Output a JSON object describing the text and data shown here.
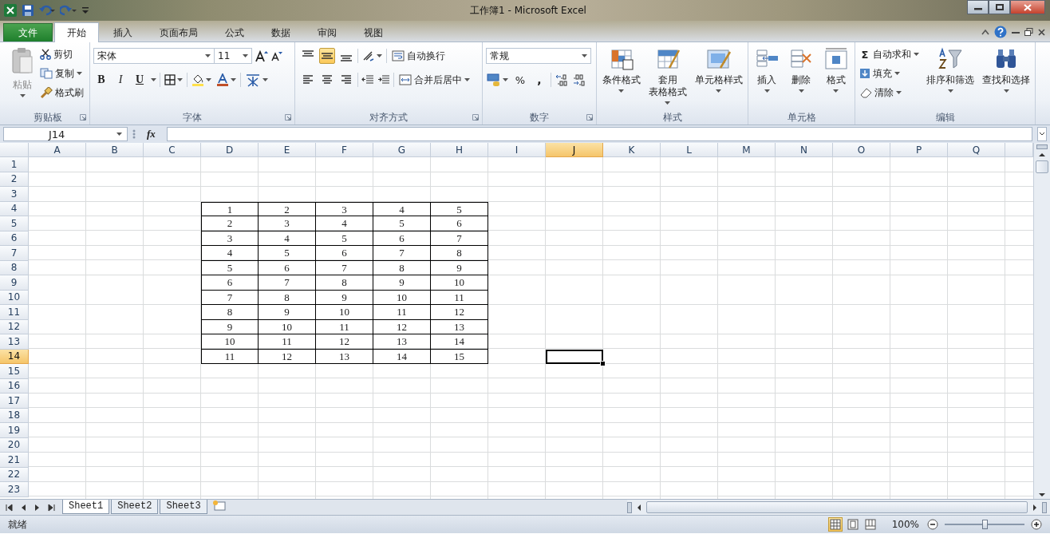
{
  "window": {
    "title": "工作簿1 - Microsoft Excel"
  },
  "ribbon_tabs": [
    {
      "label": "文件",
      "kind": "file",
      "selected": false
    },
    {
      "label": "开始",
      "kind": "tab",
      "selected": true
    },
    {
      "label": "插入",
      "kind": "tab",
      "selected": false
    },
    {
      "label": "页面布局",
      "kind": "tab",
      "selected": false
    },
    {
      "label": "公式",
      "kind": "tab",
      "selected": false
    },
    {
      "label": "数据",
      "kind": "tab",
      "selected": false
    },
    {
      "label": "审阅",
      "kind": "tab",
      "selected": false
    },
    {
      "label": "视图",
      "kind": "tab",
      "selected": false
    }
  ],
  "clipboard": {
    "label": "剪贴板",
    "paste": "粘贴",
    "cut": "剪切",
    "copy": "复制",
    "format_painter": "格式刷"
  },
  "font": {
    "label": "字体",
    "font_name": "宋体",
    "font_size": "11",
    "bold": "B",
    "italic": "I",
    "underline": "U"
  },
  "alignment": {
    "label": "对齐方式",
    "vertical": [
      {
        "selected": false
      },
      {
        "selected": true
      },
      {
        "selected": false
      }
    ],
    "wrap_text": "自动换行",
    "merge_center": "合并后居中"
  },
  "number": {
    "label": "数字",
    "format": "常规",
    "percent": "%",
    "comma": ","
  },
  "styles": {
    "label": "样式",
    "conditional_format": "条件格式",
    "table_format": [
      "套用",
      "表格格式"
    ],
    "cell_styles": "单元格样式"
  },
  "cells": {
    "label": "单元格",
    "insert": "插入",
    "delete": "删除",
    "format": "格式"
  },
  "editing": {
    "label": "编辑",
    "autosum_symbol": "Σ",
    "autosum": "自动求和",
    "fill": "填充",
    "clear": "清除",
    "sort_filter": "排序和筛选",
    "find_select": "查找和选择"
  },
  "formula_bar": {
    "name_box": "J14",
    "fx": "fx"
  },
  "columns": [
    {
      "label": "A",
      "selected": false,
      "bordered": false
    },
    {
      "label": "B",
      "selected": false,
      "bordered": false
    },
    {
      "label": "C",
      "selected": false,
      "bordered": false
    },
    {
      "label": "D",
      "selected": false,
      "bordered": true
    },
    {
      "label": "E",
      "selected": false,
      "bordered": true
    },
    {
      "label": "F",
      "selected": false,
      "bordered": true
    },
    {
      "label": "G",
      "selected": false,
      "bordered": true
    },
    {
      "label": "H",
      "selected": false,
      "bordered": true
    },
    {
      "label": "I",
      "selected": false,
      "bordered": false
    },
    {
      "label": "J",
      "selected": true,
      "bordered": false
    },
    {
      "label": "K",
      "selected": false,
      "bordered": false
    },
    {
      "label": "L",
      "selected": false,
      "bordered": false
    },
    {
      "label": "M",
      "selected": false,
      "bordered": false
    },
    {
      "label": "N",
      "selected": false,
      "bordered": false
    },
    {
      "label": "O",
      "selected": false,
      "bordered": false
    },
    {
      "label": "P",
      "selected": false,
      "bordered": false
    },
    {
      "label": "Q",
      "selected": false,
      "bordered": false
    }
  ],
  "rows": [
    {
      "label": "1",
      "selected": false,
      "bordered": false
    },
    {
      "label": "2",
      "selected": false,
      "bordered": false
    },
    {
      "label": "3",
      "selected": false,
      "bordered": false
    },
    {
      "label": "4",
      "selected": false,
      "bordered": true,
      "values": [
        "1",
        "2",
        "3",
        "4",
        "5"
      ]
    },
    {
      "label": "5",
      "selected": false,
      "bordered": true,
      "values": [
        "2",
        "3",
        "4",
        "5",
        "6"
      ]
    },
    {
      "label": "6",
      "selected": false,
      "bordered": true,
      "values": [
        "3",
        "4",
        "5",
        "6",
        "7"
      ]
    },
    {
      "label": "7",
      "selected": false,
      "bordered": true,
      "values": [
        "4",
        "5",
        "6",
        "7",
        "8"
      ]
    },
    {
      "label": "8",
      "selected": false,
      "bordered": true,
      "values": [
        "5",
        "6",
        "7",
        "8",
        "9"
      ]
    },
    {
      "label": "9",
      "selected": false,
      "bordered": true,
      "values": [
        "6",
        "7",
        "8",
        "9",
        "10"
      ]
    },
    {
      "label": "10",
      "selected": false,
      "bordered": true,
      "values": [
        "7",
        "8",
        "9",
        "10",
        "11"
      ]
    },
    {
      "label": "11",
      "selected": false,
      "bordered": true,
      "values": [
        "8",
        "9",
        "10",
        "11",
        "12"
      ]
    },
    {
      "label": "12",
      "selected": false,
      "bordered": true,
      "values": [
        "9",
        "10",
        "11",
        "12",
        "13"
      ]
    },
    {
      "label": "13",
      "selected": false,
      "bordered": true,
      "values": [
        "10",
        "11",
        "12",
        "13",
        "14"
      ]
    },
    {
      "label": "14",
      "selected": true,
      "bordered": true,
      "values": [
        "11",
        "12",
        "13",
        "14",
        "15"
      ]
    },
    {
      "label": "15",
      "selected": false,
      "bordered": false
    },
    {
      "label": "16",
      "selected": false,
      "bordered": false
    },
    {
      "label": "17",
      "selected": false,
      "bordered": false
    },
    {
      "label": "18",
      "selected": false,
      "bordered": false
    },
    {
      "label": "19",
      "selected": false,
      "bordered": false
    },
    {
      "label": "20",
      "selected": false,
      "bordered": false
    },
    {
      "label": "21",
      "selected": false,
      "bordered": false
    },
    {
      "label": "22",
      "selected": false,
      "bordered": false
    },
    {
      "label": "23",
      "selected": false,
      "bordered": false
    }
  ],
  "sheets": [
    {
      "label": "Sheet1",
      "selected": true
    },
    {
      "label": "Sheet2",
      "selected": false
    },
    {
      "label": "Sheet3",
      "selected": false
    }
  ],
  "status_bar": {
    "status": "就绪",
    "views": [
      {
        "selected": true
      },
      {
        "selected": false
      },
      {
        "selected": false
      }
    ],
    "zoom": "100%",
    "zoom_slider": {
      "level": 0.5
    }
  }
}
